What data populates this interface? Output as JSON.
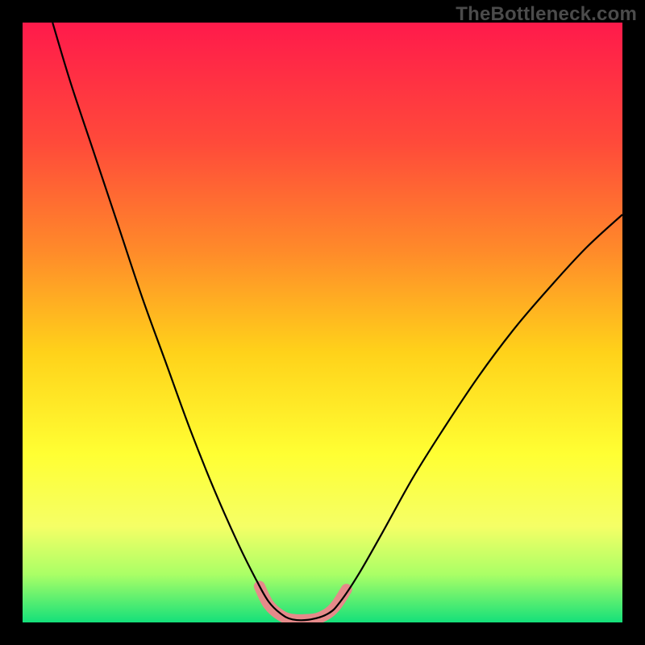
{
  "watermark": "TheBottleneck.com",
  "chart_data": {
    "type": "line",
    "title": "",
    "xlabel": "",
    "ylabel": "",
    "xlim": [
      0,
      100
    ],
    "ylim": [
      0,
      100
    ],
    "grid": false,
    "legend": false,
    "background_gradient": {
      "stops": [
        {
          "pos": 0.0,
          "color": "#ff1a4b"
        },
        {
          "pos": 0.2,
          "color": "#ff4a3a"
        },
        {
          "pos": 0.38,
          "color": "#ff8a2a"
        },
        {
          "pos": 0.55,
          "color": "#ffd21a"
        },
        {
          "pos": 0.72,
          "color": "#ffff33"
        },
        {
          "pos": 0.84,
          "color": "#f5ff66"
        },
        {
          "pos": 0.92,
          "color": "#aaff66"
        },
        {
          "pos": 1.0,
          "color": "#14e07a"
        }
      ]
    },
    "series": [
      {
        "name": "bottleneck-curve",
        "color": "#000000",
        "width": 2.2,
        "points": [
          {
            "x": 5.0,
            "y": 100.0
          },
          {
            "x": 8.0,
            "y": 90.0
          },
          {
            "x": 12.0,
            "y": 78.0
          },
          {
            "x": 16.0,
            "y": 66.0
          },
          {
            "x": 20.0,
            "y": 54.0
          },
          {
            "x": 24.0,
            "y": 43.0
          },
          {
            "x": 28.0,
            "y": 32.0
          },
          {
            "x": 32.0,
            "y": 22.0
          },
          {
            "x": 36.0,
            "y": 13.0
          },
          {
            "x": 39.0,
            "y": 7.0
          },
          {
            "x": 41.0,
            "y": 3.5
          },
          {
            "x": 43.0,
            "y": 1.5
          },
          {
            "x": 45.0,
            "y": 0.5
          },
          {
            "x": 48.0,
            "y": 0.5
          },
          {
            "x": 51.0,
            "y": 1.5
          },
          {
            "x": 53.0,
            "y": 3.5
          },
          {
            "x": 56.0,
            "y": 8.0
          },
          {
            "x": 60.0,
            "y": 15.0
          },
          {
            "x": 65.0,
            "y": 24.0
          },
          {
            "x": 70.0,
            "y": 32.0
          },
          {
            "x": 76.0,
            "y": 41.0
          },
          {
            "x": 82.0,
            "y": 49.0
          },
          {
            "x": 88.0,
            "y": 56.0
          },
          {
            "x": 94.0,
            "y": 62.5
          },
          {
            "x": 100.0,
            "y": 68.0
          }
        ]
      },
      {
        "name": "bottom-highlight",
        "color": "#e58a8a",
        "width": 14,
        "linecap": "round",
        "points": [
          {
            "x": 39.5,
            "y": 6.0
          },
          {
            "x": 41.0,
            "y": 3.0
          },
          {
            "x": 43.0,
            "y": 1.2
          },
          {
            "x": 45.0,
            "y": 0.5
          },
          {
            "x": 48.0,
            "y": 0.5
          },
          {
            "x": 50.0,
            "y": 1.0
          },
          {
            "x": 52.0,
            "y": 2.5
          },
          {
            "x": 54.0,
            "y": 5.5
          }
        ]
      }
    ]
  }
}
